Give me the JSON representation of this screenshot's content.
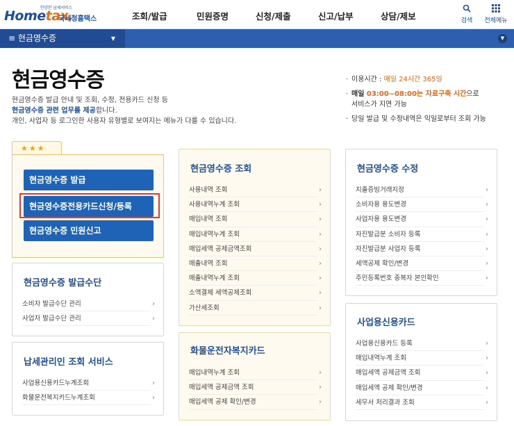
{
  "header": {
    "logo_small": "안녕한 납세서비스",
    "logo_home": "Home",
    "logo_tax": "tax.",
    "logo_sub": "국세청홈택스",
    "menus": [
      "조회/발급",
      "민원증명",
      "신청/제출",
      "신고/납부",
      "상담/제보"
    ],
    "search_label": "검색",
    "allmenu_label": "전체메뉴"
  },
  "bluebar": {
    "crumb": "현금영수증"
  },
  "page": {
    "title": "현금영수증",
    "desc_line1": "현금영수증 발급 안내 및 조회, 수정, 전용카드 신청 등",
    "desc_line2_hl": "현금영수증 관련 업무를 제공",
    "desc_line2_rest": "합니다.",
    "desc_line3": "개인, 사업자 등 로그인한 사용자 유형별로 보여지는 메뉴가 다를 수 있습니다."
  },
  "notes": {
    "n1_label": "이용시간 : ",
    "n1_value": "매일 24시간 365일",
    "n2_a": "매일 ",
    "n2_b": "03:00~08:00는 자료구축 시간",
    "n2_c": "으로",
    "n2_d": "서비스가 지연 가능",
    "n3": "당일 발급 및 수정내역은 익일로부터 조회 가능"
  },
  "quick": {
    "stars": "★★★",
    "buttons": [
      "현금영수증 발급",
      "현금영수증전용카드신청/등록",
      "현금영수증 민원신고"
    ]
  },
  "cards": {
    "issue_means": {
      "title": "현금영수증 발급수단",
      "items": [
        "소비자 발급수단 관리",
        "사업자 발급수단 관리"
      ]
    },
    "tax_manager": {
      "title": "납세관리인 조회 서비스",
      "items": [
        "사업용신용카드누계조회",
        "화물운전복지카드누계조회"
      ]
    },
    "inquiry": {
      "title": "현금영수증 조회",
      "items": [
        "사용내역 조회",
        "사용내역누계 조회",
        "매입내역 조회",
        "매입내역누계 조회",
        "매입세액 공제금액조회",
        "매출내역 조회",
        "매출내역누계 조회",
        "소액결제 세액공제조회",
        "가산세조회"
      ]
    },
    "freight": {
      "title": "화물운전자복지카드",
      "items": [
        "매입내역누계 조회",
        "매입세액 공제금액 조회",
        "매입세액 공제 확인/변경"
      ]
    },
    "modify": {
      "title": "현금영수증 수정",
      "items": [
        "지출증빙거래지정",
        "소비자용 용도변경",
        "사업자용 용도변경",
        "자진발급분 소비자 등록",
        "자진발급분 사업자 등록",
        "세액공제 확인/변경",
        "주민등록번호 중복자 본인확인"
      ]
    },
    "biz_card": {
      "title": "사업용신용카드",
      "items": [
        "사업용신용카드 등록",
        "매입내역누계 조회",
        "매입세액 공제금액 조회",
        "매입세액 공제 확인/변경",
        "세무서 처리결과 조회"
      ]
    }
  },
  "colors": {
    "brand_blue": "#1d4f9e",
    "button_blue": "#1e63b5",
    "highlight_red": "#e03a3a",
    "accent_orange": "#e0661a"
  }
}
